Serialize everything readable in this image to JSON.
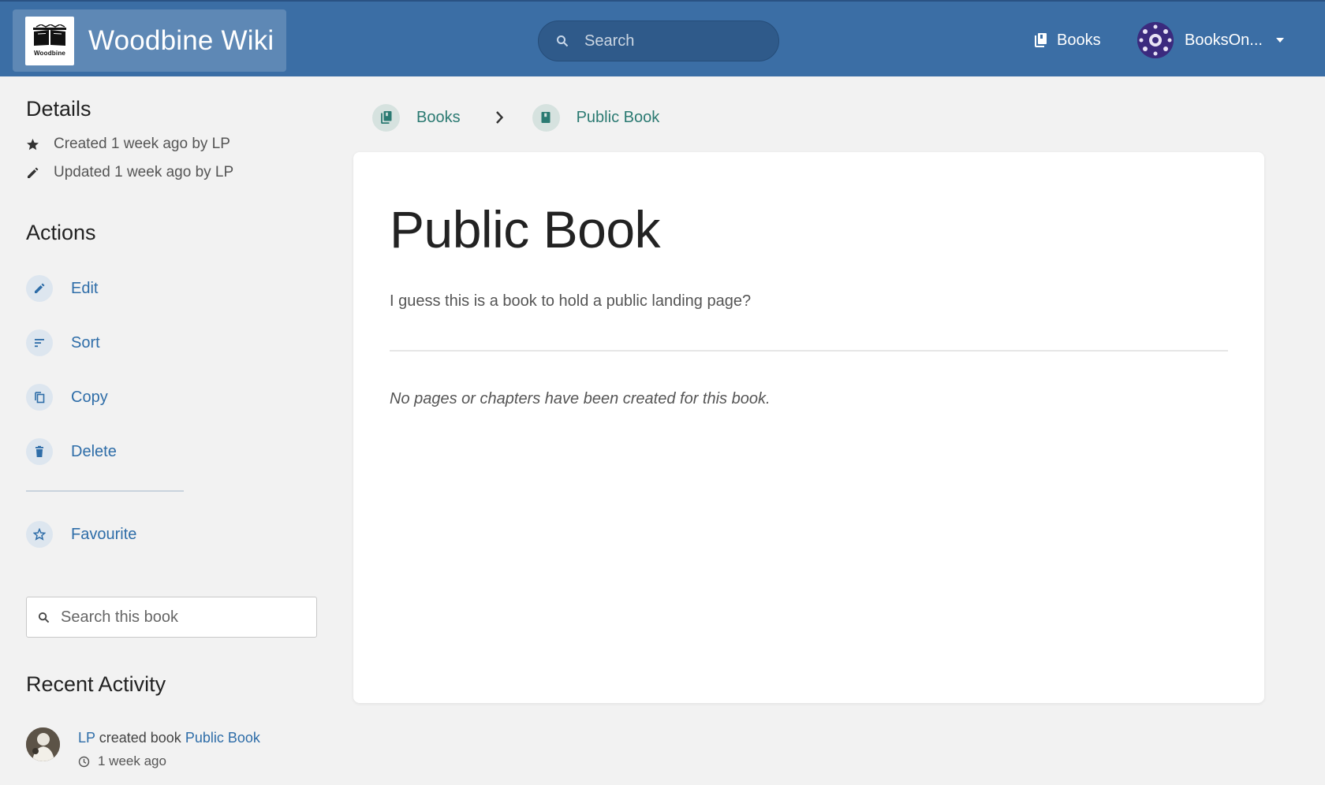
{
  "header": {
    "logo_text": "Woodbine",
    "site_name": "Woodbine Wiki",
    "search_placeholder": "Search",
    "nav_books_label": "Books",
    "user_name": "BooksOn..."
  },
  "breadcrumb": {
    "items": [
      "Books",
      "Public Book"
    ]
  },
  "book": {
    "title": "Public Book",
    "description": "I guess this is a book to hold a public landing page?",
    "empty_message": "No pages or chapters have been created for this book."
  },
  "sidebar": {
    "details_title": "Details",
    "created": "Created 1 week ago by LP",
    "updated": "Updated 1 week ago by LP",
    "actions_title": "Actions",
    "actions": {
      "edit": "Edit",
      "sort": "Sort",
      "copy": "Copy",
      "delete": "Delete",
      "favourite": "Favourite"
    },
    "search_placeholder": "Search this book",
    "activity_title": "Recent Activity",
    "activity": {
      "user": "LP",
      "verb": "created book",
      "target": "Public Book",
      "time": "1 week ago"
    }
  },
  "colors": {
    "header_bg": "#3b6ea5",
    "link": "#2e6da8",
    "book_accent": "#2b7a72",
    "page_bg": "#f2f2f2"
  }
}
